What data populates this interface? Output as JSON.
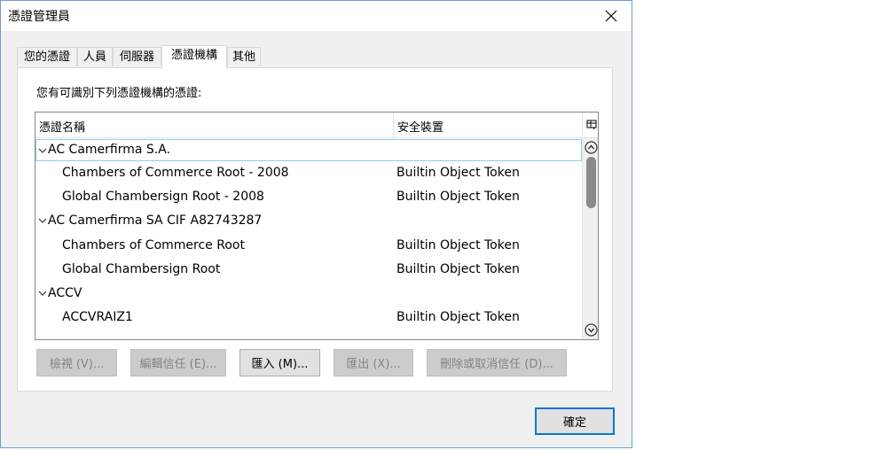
{
  "window": {
    "title": "憑證管理員"
  },
  "tabs": [
    {
      "label": "您的憑證"
    },
    {
      "label": "人員"
    },
    {
      "label": "伺服器"
    },
    {
      "label": "憑證機構"
    },
    {
      "label": "其他"
    }
  ],
  "active_tab": "憑證機構",
  "panel": {
    "description": "您有可識別下列憑證機構的憑證:"
  },
  "tree": {
    "columns": {
      "name": "憑證名稱",
      "device": "安全裝置"
    },
    "rows": [
      {
        "type": "group",
        "name": "AC Camerfirma S.A.",
        "device": "",
        "selected": true
      },
      {
        "type": "cert",
        "name": "Chambers of Commerce Root - 2008",
        "device": "Builtin Object Token"
      },
      {
        "type": "cert",
        "name": "Global Chambersign Root - 2008",
        "device": "Builtin Object Token"
      },
      {
        "type": "group",
        "name": "AC Camerfirma SA CIF A82743287",
        "device": ""
      },
      {
        "type": "cert",
        "name": "Chambers of Commerce Root",
        "device": "Builtin Object Token"
      },
      {
        "type": "cert",
        "name": "Global Chambersign Root",
        "device": "Builtin Object Token"
      },
      {
        "type": "group",
        "name": "ACCV",
        "device": ""
      },
      {
        "type": "cert",
        "name": "ACCVRAIZ1",
        "device": "Builtin Object Token"
      }
    ]
  },
  "buttons": {
    "view": "檢視 (V)...",
    "edit_trust": "編輯信任 (E)...",
    "import": "匯入 (M)...",
    "export": "匯出 (X)...",
    "delete": "刪除或取消信任 (D)..."
  },
  "ok_label": "確定",
  "icons": {
    "close": "close-icon",
    "chevron": "chevron-down-icon",
    "column_picker": "column-picker-icon",
    "scroll_up": "scroll-up-icon",
    "scroll_down": "scroll-down-icon"
  }
}
